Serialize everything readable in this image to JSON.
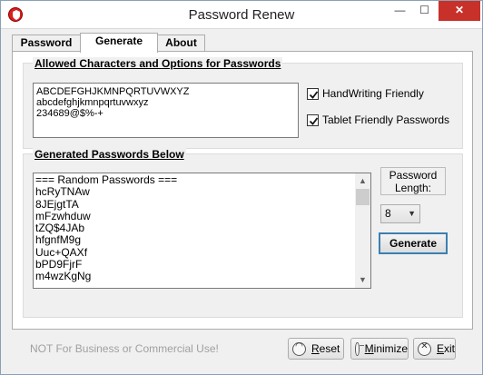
{
  "window": {
    "title": "Password Renew",
    "minimize_glyph": "—",
    "maximize_glyph": "☐",
    "close_glyph": "✕"
  },
  "tabs": [
    {
      "label": "Password",
      "active": false
    },
    {
      "label": "Generate",
      "active": true
    },
    {
      "label": "About",
      "active": false
    }
  ],
  "options": {
    "title": "Allowed Characters and Options for Passwords",
    "allowed_chars": [
      "ABCDEFGHJKMNPQRTUVWXYZ",
      "abcdefghjkmnpqrtuvwxyz",
      "234689@$%-+"
    ],
    "handwriting": {
      "label": "HandWriting Friendly",
      "checked": true
    },
    "tablet": {
      "label": "Tablet Friendly Passwords",
      "checked": true
    }
  },
  "generated": {
    "title": "Generated Passwords Below",
    "lines": [
      "=== Random Passwords ===",
      "hcRyTNAw",
      "8JEjgtTA",
      "mFzwhduw",
      "tZQ$4JAb",
      "hfgnfM9g",
      "Uuc+QAXf",
      "bPD9FjrF",
      "m4wzKgNg"
    ]
  },
  "length": {
    "label": "Password Length:",
    "value": "8"
  },
  "buttons": {
    "generate": "Generate",
    "reset": "Reset",
    "minimize": "Minimize",
    "exit": "Exit"
  },
  "footer_note": "NOT For Business or Commercial Use!",
  "icons": {
    "app": "shield-icon",
    "reset": "reset-icon",
    "minimize": "minimize-icon",
    "exit": "exit-icon"
  },
  "colors": {
    "accent": "#3c7fb1",
    "close": "#c7312a",
    "app_icon": "#d81e1e"
  }
}
